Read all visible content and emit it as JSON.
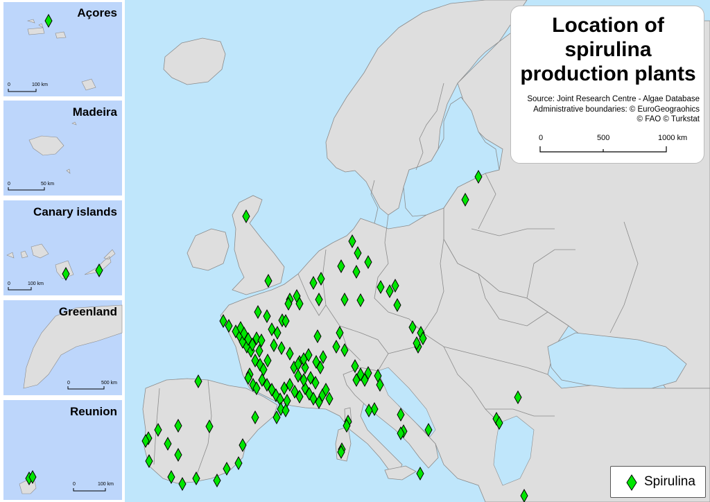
{
  "title": "Location of spirulina production plants",
  "title_lines": [
    "Location of",
    "spirulina",
    "production plants"
  ],
  "source_lines": [
    "Source: Joint Research Centre - Algae Database",
    "Administrative boundaries: © EuroGeograohics",
    "© FAO © Turkstat"
  ],
  "main_scale": {
    "labels": [
      "0",
      "500",
      "1000 km"
    ]
  },
  "legend": {
    "label": "Spirulina",
    "symbol": "diamond-icon"
  },
  "colors": {
    "sea": "#bfe6fb",
    "inset_sea": "#bdd6fb",
    "land": "#dedede",
    "border": "#8a8a8a",
    "marker": "#00e600"
  },
  "insets": [
    {
      "name": "Açores",
      "scale_labels": [
        "0",
        "100 km"
      ]
    },
    {
      "name": "Madeira",
      "scale_labels": [
        "0",
        "50 km"
      ]
    },
    {
      "name": "Canary islands",
      "scale_labels": [
        "0",
        "100 km"
      ]
    },
    {
      "name": "Greenland",
      "scale_labels": [
        "0",
        "500 km"
      ]
    },
    {
      "name": "Reunion",
      "scale_labels": [
        "0",
        "100 km"
      ]
    }
  ]
}
